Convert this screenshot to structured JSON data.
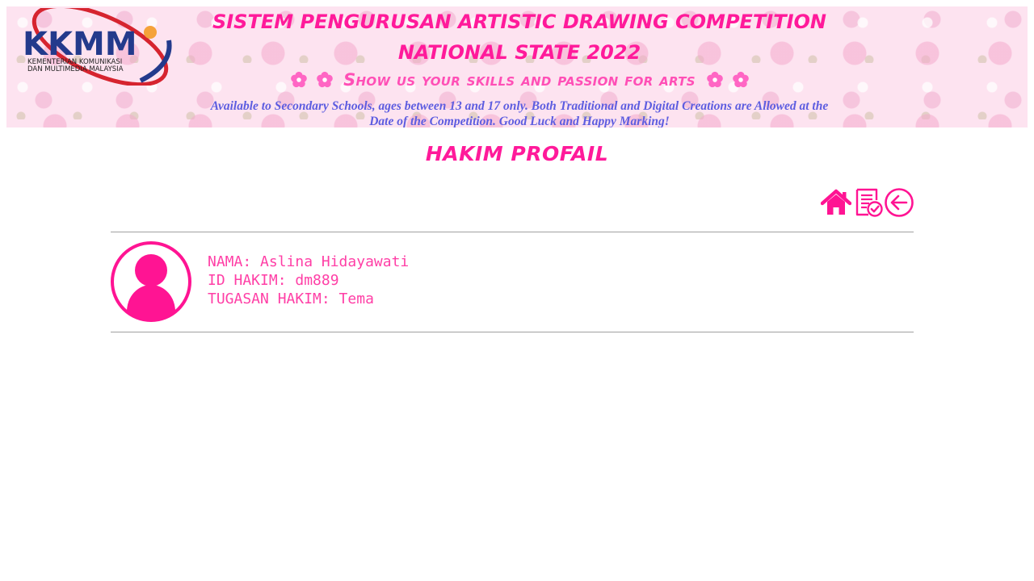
{
  "header": {
    "logo_text": "KKMM",
    "logo_subtitle_1": "KEMENTERIAN KOMUNIKASI",
    "logo_subtitle_2": "DAN MULTIMEDIA MALAYSIA",
    "title_line_1": "SISTEM PENGURUSAN ARTISTIC DRAWING COMPETITION",
    "title_line_2": "NATIONAL STATE 2022",
    "slogan": "Show us your skills and passion for arts",
    "description_line_1": "Available to Secondary Schools, ages between 13 and 17 only. Both Traditional and Digital Creations are Allowed at the",
    "description_line_2": "Date of the Competition. Good Luck and Happy Marking!"
  },
  "page": {
    "title": "HAKIM PROFAIL"
  },
  "toolbar": {
    "icons": [
      "home-icon",
      "marking-list-icon",
      "back-arrow-icon"
    ]
  },
  "profile": {
    "name_line": "NAMA: Aslina Hidayawati",
    "id_line": "ID HAKIM: dm889",
    "task_line": "TUGASAN HAKIM: Tema"
  },
  "colors": {
    "accent_pink": "#ff1a9a",
    "icon_pink": "#ff1493",
    "description_purple": "#5d5de0",
    "logo_navy": "#233a8c",
    "logo_red": "#d6242f",
    "logo_orange": "#f5a23a"
  }
}
